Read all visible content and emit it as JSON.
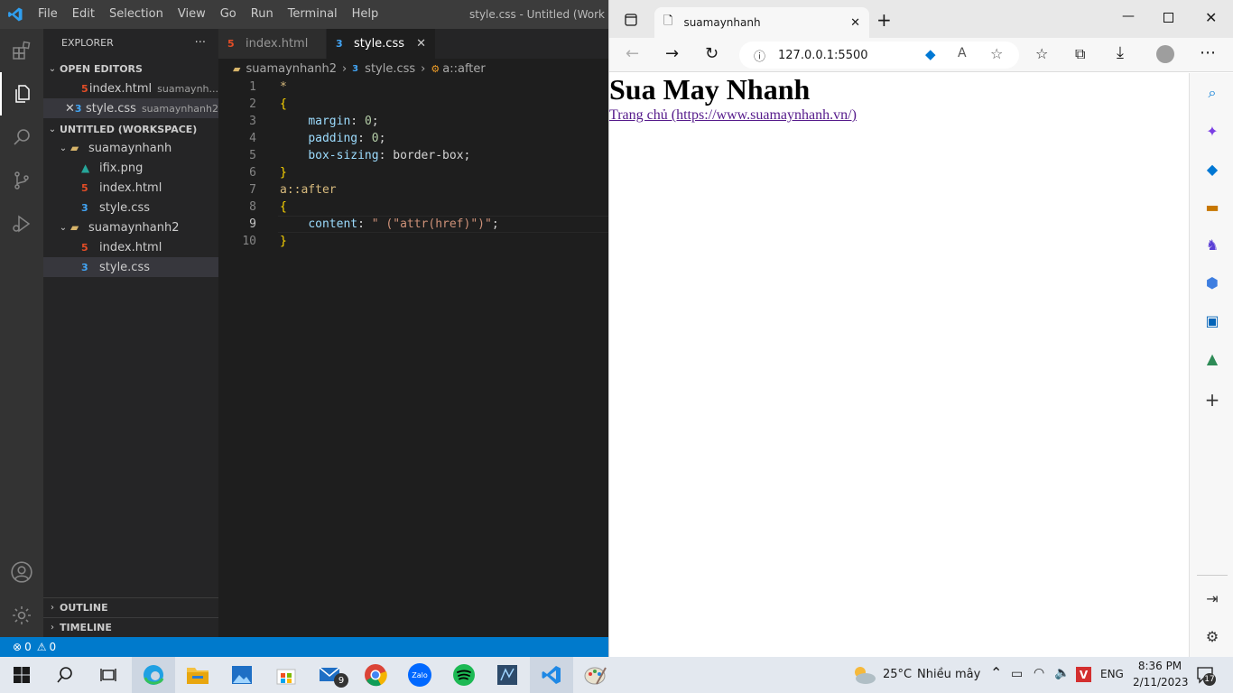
{
  "vscode": {
    "menu": [
      "File",
      "Edit",
      "Selection",
      "View",
      "Go",
      "Run",
      "Terminal",
      "Help"
    ],
    "window_title": "style.css - Untitled (Work",
    "explorer_title": "EXPLORER",
    "explorer_more": "···",
    "open_editors_label": "OPEN EDITORS",
    "open_editors": [
      {
        "name": "index.html",
        "folder": "suamaynh...",
        "type": "html"
      },
      {
        "name": "style.css",
        "folder": "suamaynhanh2",
        "type": "css"
      }
    ],
    "workspace_label": "UNTITLED (WORKSPACE)",
    "folder1": {
      "name": "suamaynhanh",
      "files": [
        {
          "name": "ifix.png",
          "type": "png"
        },
        {
          "name": "index.html",
          "type": "html"
        },
        {
          "name": "style.css",
          "type": "css"
        }
      ]
    },
    "folder2": {
      "name": "suamaynhanh2",
      "files": [
        {
          "name": "index.html",
          "type": "html"
        },
        {
          "name": "style.css",
          "type": "css"
        }
      ]
    },
    "outline_label": "OUTLINE",
    "timeline_label": "TIMELINE",
    "tabs": [
      {
        "label": "index.html",
        "type": "html"
      },
      {
        "label": "style.css",
        "type": "css",
        "active": true
      }
    ],
    "breadcrumb": {
      "folder": "suamaynhanh2",
      "file": "style.css",
      "symbol": "a::after"
    },
    "code": {
      "line_numbers": [
        "1",
        "2",
        "3",
        "4",
        "5",
        "6",
        "7",
        "8",
        "9",
        "10"
      ],
      "l1": "*",
      "l2": "{",
      "l3_prop": "margin",
      "l3_val": "0",
      "l4_prop": "padding",
      "l4_val": "0",
      "l5_prop": "box-sizing",
      "l5_val": "border-box",
      "l6": "}",
      "l7": "a::after",
      "l8": "{",
      "l9_prop": "content",
      "l9_val": "\" (\"attr(href)\")\"",
      "l10": "}"
    },
    "status": {
      "errors": "0",
      "warnings": "0"
    }
  },
  "browser": {
    "tab_title": "suamaynhanh",
    "url": "127.0.0.1:5500",
    "page_heading": "Sua May Nhanh",
    "page_link": "Trang chủ (https://www.suamaynhanh.vn/)"
  },
  "taskbar": {
    "weather_temp": "25°C",
    "weather_text": "Nhiều mây",
    "language": "ENG",
    "time": "8:36 PM",
    "date": "2/11/2023",
    "mail_badge": "9",
    "notif_badge": "17"
  },
  "colors": {
    "vscode_accent": "#007acc",
    "edge_accent": "#0078d4",
    "link": "#551a8b"
  }
}
